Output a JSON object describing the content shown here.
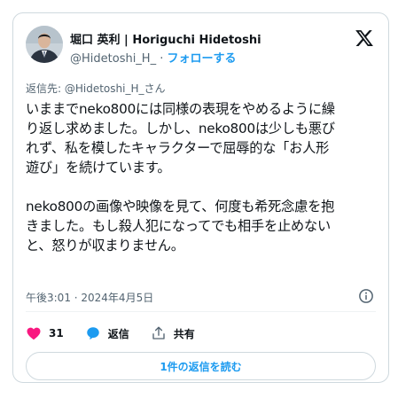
{
  "author": {
    "display_name": "堀口 英利 | Horiguchi Hidetoshi",
    "handle": "@Hidetoshi_H_",
    "separator": "·",
    "follow_label": "フォローする"
  },
  "reply_to": "返信先: @Hidetoshi_H_さん",
  "body_lines": [
    "いままでneko800には同様の表現をやめるように繰",
    "り返し求めました。しかし、neko800は少しも悪び",
    "れず、私を模したキャラクターで屈辱的な「お人形",
    "遊び」を続けています。",
    "",
    "neko800の画像や映像を見て、何度も希死念慮を抱",
    "きました。もし殺人犯になってでも相手を止めない",
    "と、怒りが収まりません。"
  ],
  "timestamp": "午後3:01 · 2024年4月5日",
  "actions": {
    "like_count": "31",
    "reply_label": "返信",
    "share_label": "共有"
  },
  "read_replies_label": "1件の返信を読む",
  "colors": {
    "accent": "#1d9bf0",
    "like": "#f91880",
    "text": "#0f1419",
    "secondary": "#536471",
    "border": "#cfd9de"
  },
  "icons": [
    "x-logo-icon",
    "info-icon",
    "heart-icon",
    "reply-bubble-icon",
    "share-icon"
  ]
}
